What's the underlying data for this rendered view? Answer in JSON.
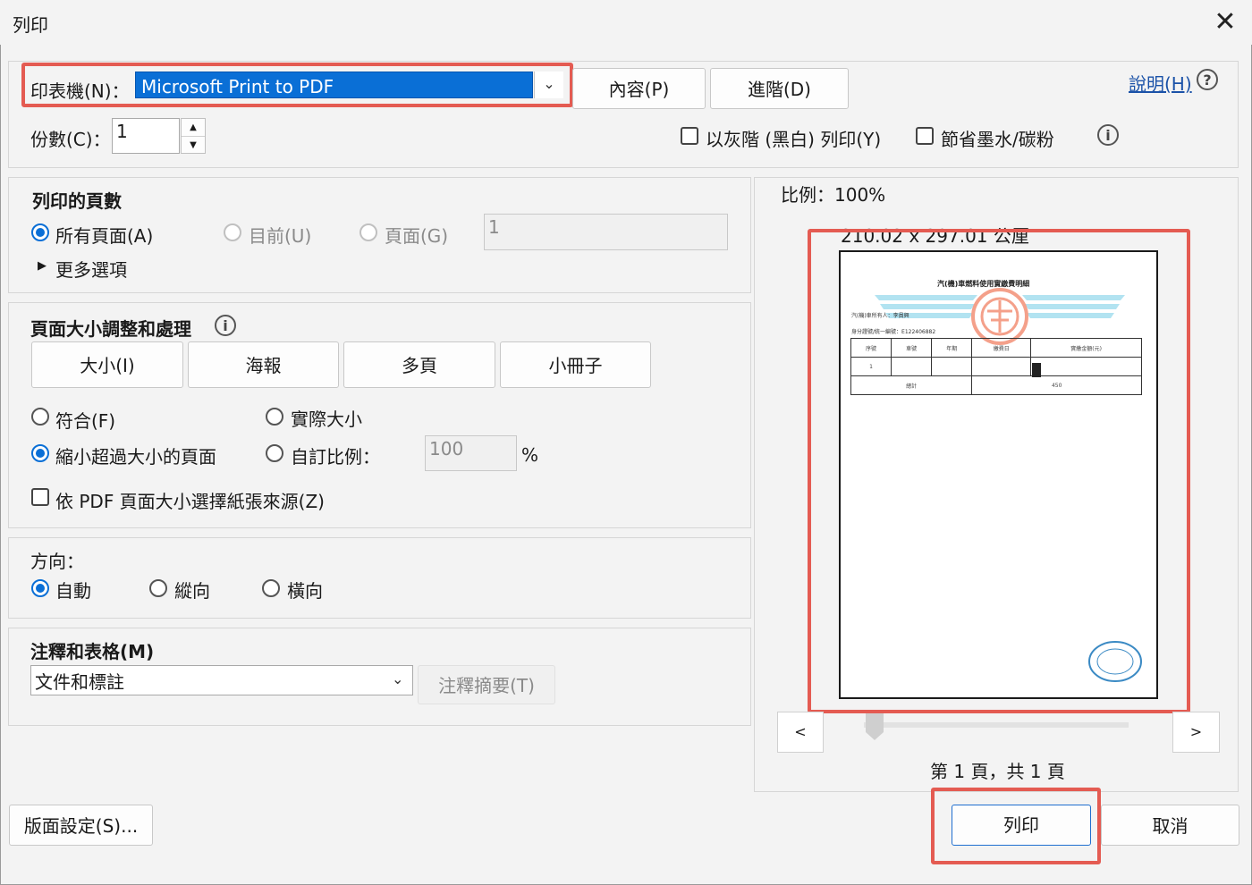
{
  "window": {
    "title": "列印",
    "close_glyph": "✕"
  },
  "printer": {
    "label": "印表機(N)：",
    "selected": "Microsoft Print to PDF",
    "properties_button": "內容(P)",
    "advanced_button": "進階(D)"
  },
  "help": {
    "link": "說明(H)",
    "icon": "?"
  },
  "copies": {
    "label": "份數(C)：",
    "value": "1"
  },
  "options": {
    "grayscale": "以灰階 (黑白) 列印(Y)",
    "save_ink": "節省墨水/碳粉",
    "info_icon": "i"
  },
  "pages_to_print": {
    "heading": "列印的頁數",
    "all": "所有頁面(A)",
    "current": "目前(U)",
    "pages": "頁面(G)",
    "pages_value": "1",
    "more_options": "更多選項"
  },
  "page_sizing": {
    "heading": "頁面大小調整和處理",
    "info_icon": "i",
    "tabs": [
      "大小(I)",
      "海報",
      "多頁",
      "小冊子"
    ],
    "fit": "符合(F)",
    "actual_size": "實際大小",
    "shrink": "縮小超過大小的頁面",
    "custom_scale": "自訂比例：",
    "scale_value": "100",
    "percent": "%",
    "choose_paper": "依 PDF 頁面大小選擇紙張來源(Z)"
  },
  "orientation": {
    "heading": "方向：",
    "auto": "自動",
    "portrait": "縱向",
    "landscape": "橫向"
  },
  "comments": {
    "heading": "注釋和表格(M)",
    "selected": "文件和標註",
    "summary_button": "注釋摘要(T)"
  },
  "preview": {
    "scale": "比例：100%",
    "dimensions": "210.02 x 297.01 公厘",
    "prev": "<",
    "next": ">",
    "page_status": "第 1 頁，共 1 頁",
    "document": {
      "title": "汽(機)車燃料使用實繳費明細",
      "owner": "汽(機)車所有人：李員興",
      "id_line": "身分證號/統一編號：E122406882",
      "headers": [
        "序號",
        "車號",
        "年期",
        "繳費日",
        "實繳金額(元)"
      ],
      "row": [
        "1",
        "",
        "",
        "",
        ""
      ],
      "total_label": "總計",
      "total_value": "450"
    }
  },
  "footer": {
    "page_setup": "版面設定(S)...",
    "print": "列印",
    "cancel": "取消"
  }
}
